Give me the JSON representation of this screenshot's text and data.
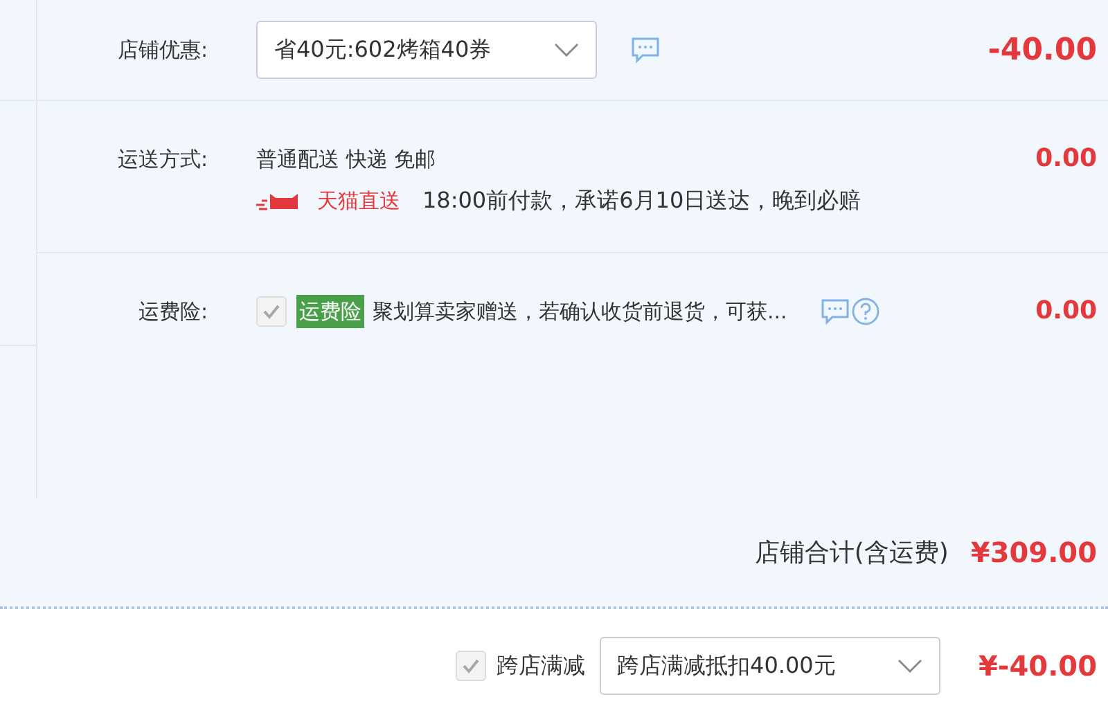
{
  "shop_discount": {
    "label": "店铺优惠:",
    "dropdown_value": "省40元:602烤箱40券",
    "amount": "-40.00"
  },
  "shipping": {
    "label": "运送方式:",
    "method": "普通配送 快递 免邮",
    "badge": "天猫直送",
    "promise": "18:00前付款，承诺6月10日送达，晚到必赔",
    "amount": "0.00"
  },
  "insurance": {
    "label": "运费险:",
    "checked": true,
    "disabled": true,
    "tag": "运费险",
    "description": "聚划算卖家赠送，若确认收货前退货，可获...",
    "amount": "0.00"
  },
  "shop_total": {
    "label": "店铺合计(含运费)",
    "amount": "¥309.00"
  },
  "cross_store": {
    "checked": true,
    "disabled": true,
    "label": "跨店满减",
    "dropdown_value": "跨店满减抵扣40.00元",
    "amount": "¥-40.00"
  }
}
